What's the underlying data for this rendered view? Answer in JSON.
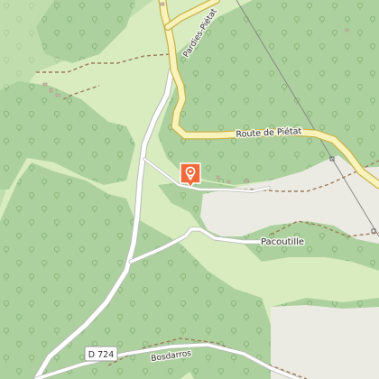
{
  "map": {
    "colors": {
      "meadow": "#d8ecc0",
      "forest": "#add19e",
      "forest_dark": "#9fc88e",
      "tree_symbol": "#8cb87c",
      "bare_area": "#ecebe3",
      "main_road_fill": "#f7f3bb",
      "main_road_casing": "#c8b24a",
      "minor_road_fill": "#ffffff",
      "minor_road_casing": "#b9b9b9",
      "track": "#9c7b57",
      "powerline": "#888888",
      "marker": "#f26a3a"
    },
    "roads": {
      "route_de_pietat": "Route de Piétat",
      "pardies_pietat": "Pardies-Piétat",
      "d724_ref": "D 724",
      "bosdarros": "Bosdarros"
    },
    "places": {
      "pacoutille": "Pacoutille"
    },
    "poi_marker": {
      "icon": "map-pin-icon"
    }
  }
}
